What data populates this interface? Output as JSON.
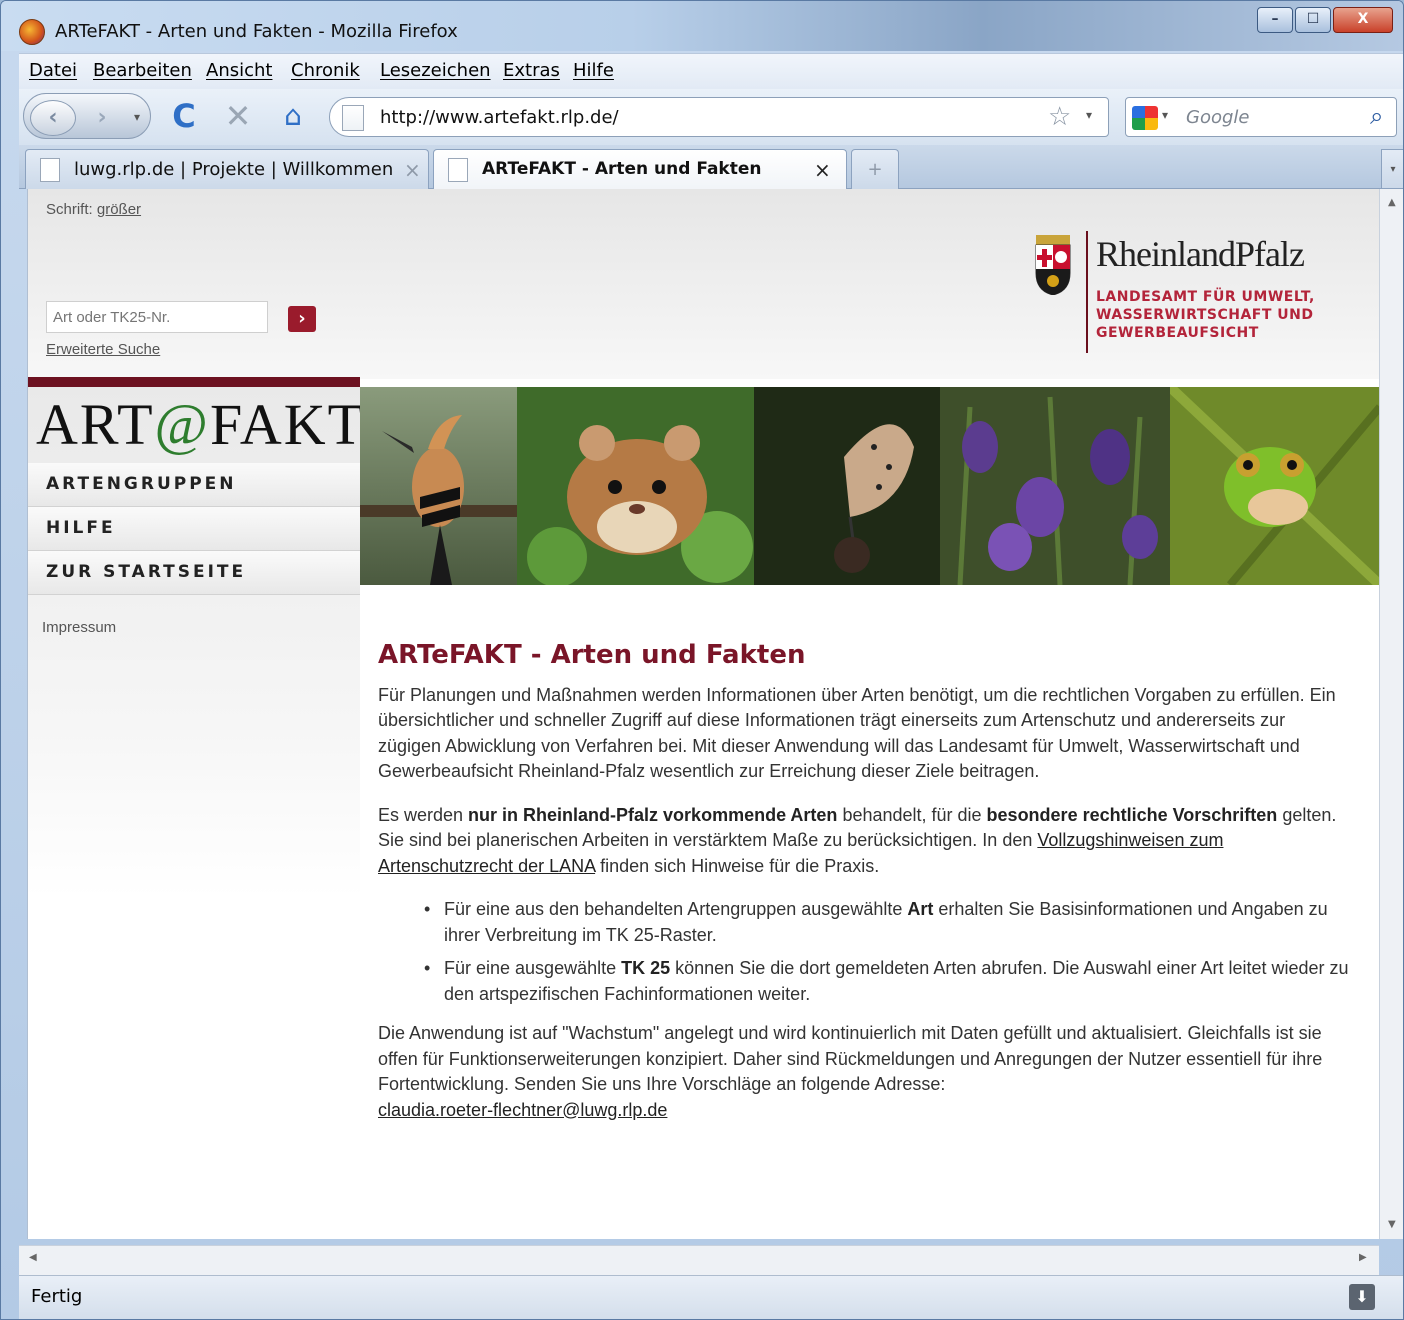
{
  "window": {
    "title": "ARTeFAKT - Arten und Fakten - Mozilla Firefox",
    "min_label": "–",
    "max_label": "☐",
    "close_label": "X"
  },
  "menu": [
    "Datei",
    "Bearbeiten",
    "Ansicht",
    "Chronik",
    "Lesezeichen",
    "Extras",
    "Hilfe"
  ],
  "nav": {
    "back_glyph": "‹",
    "forward_glyph": "›",
    "dropdown_glyph": "▾",
    "reload_glyph": "C",
    "stop_glyph": "✕",
    "home_glyph": "⌂",
    "url": "http://www.artefakt.rlp.de/",
    "star_glyph": "☆",
    "search_placeholder": "Google",
    "search_go_glyph": "⌕"
  },
  "tabs": [
    {
      "label": "luwg.rlp.de | Projekte | Willkommen",
      "close": "×",
      "active": false
    },
    {
      "label": "ARTeFAKT - Arten und Fakten",
      "close": "×",
      "active": true
    }
  ],
  "tab_extras": {
    "new_tab": "+",
    "list_tabs": "▾"
  },
  "scroll": {
    "up": "▲",
    "down": "▼",
    "left": "◀",
    "right": "▶"
  },
  "status": {
    "text": "Fertig",
    "download_glyph": "⬇"
  },
  "header": {
    "font_label": "Schrift:",
    "font_link": "größer",
    "search_placeholder": "Art oder TK25-Nr.",
    "search_submit": "›",
    "advanced_search": "Erweiterte Suche",
    "state_name": "RheinlandPfalz",
    "agency_lines": [
      "LANDESAMT FÜR UMWELT,",
      "WASSERWIRTSCHAFT UND",
      "GEWERBEAUFSICHT"
    ]
  },
  "logo": {
    "left": "ART",
    "at": "@",
    "right": "FAKT"
  },
  "sidebar": {
    "items": [
      "ARTENGRUPPEN",
      "HILFE",
      "ZUR STARTSEITE"
    ],
    "imprint": "Impressum"
  },
  "photos": [
    "hoopoe",
    "hamster",
    "butterfly",
    "iris",
    "tree-frog"
  ],
  "main": {
    "title": "ARTeFAKT - Arten und Fakten",
    "p1": "Für Planungen und Maßnahmen werden Informationen über Arten benötigt, um die rechtlichen Vorgaben zu erfüllen. Ein übersichtlicher und schneller Zugriff auf diese Informationen trägt einerseits zum Artenschutz und andererseits zur zügigen Abwicklung von Verfahren bei. Mit dieser Anwendung will das Landesamt für Umwelt, Wasserwirtschaft und Gewerbeaufsicht Rheinland-Pfalz wesentlich zur Erreichung dieser Ziele beitragen.",
    "p2_a": "Es werden ",
    "p2_b": "nur in Rheinland-Pfalz vorkommende Arten",
    "p2_c": " behandelt, für die ",
    "p2_d": "besondere rechtliche Vorschriften",
    "p2_e": " gelten. Sie sind bei planerischen Arbeiten in verstärktem Maße zu berücksichtigen. In den ",
    "p2_link": "Vollzugshinweisen zum Artenschutzrecht der LANA",
    "p2_f": " finden sich Hinweise für die Praxis.",
    "li1_a": "Für eine aus den behandelten Artengruppen ausgewählte ",
    "li1_b": "Art",
    "li1_c": " erhalten Sie Basisinformationen und Angaben zu ihrer Verbreitung im TK 25-Raster.",
    "li2_a": "Für eine ausgewählte ",
    "li2_b": "TK 25",
    "li2_c": " können Sie die dort gemeldeten Arten abrufen. Die Auswahl einer Art leitet wieder zu den artspezifischen Fachinformationen weiter.",
    "p3": "Die Anwendung ist auf \"Wachstum\" angelegt und wird kontinuierlich mit Daten gefüllt und aktualisiert. Gleichfalls ist sie offen für Funktionserweiterungen konzipiert. Daher sind Rückmeldungen und Anregungen der Nutzer essentiell für ihre Fortentwicklung. Senden Sie uns Ihre Vorschläge an folgende Adresse:",
    "email": "claudia.roeter-flechtner@luwg.rlp.de"
  }
}
